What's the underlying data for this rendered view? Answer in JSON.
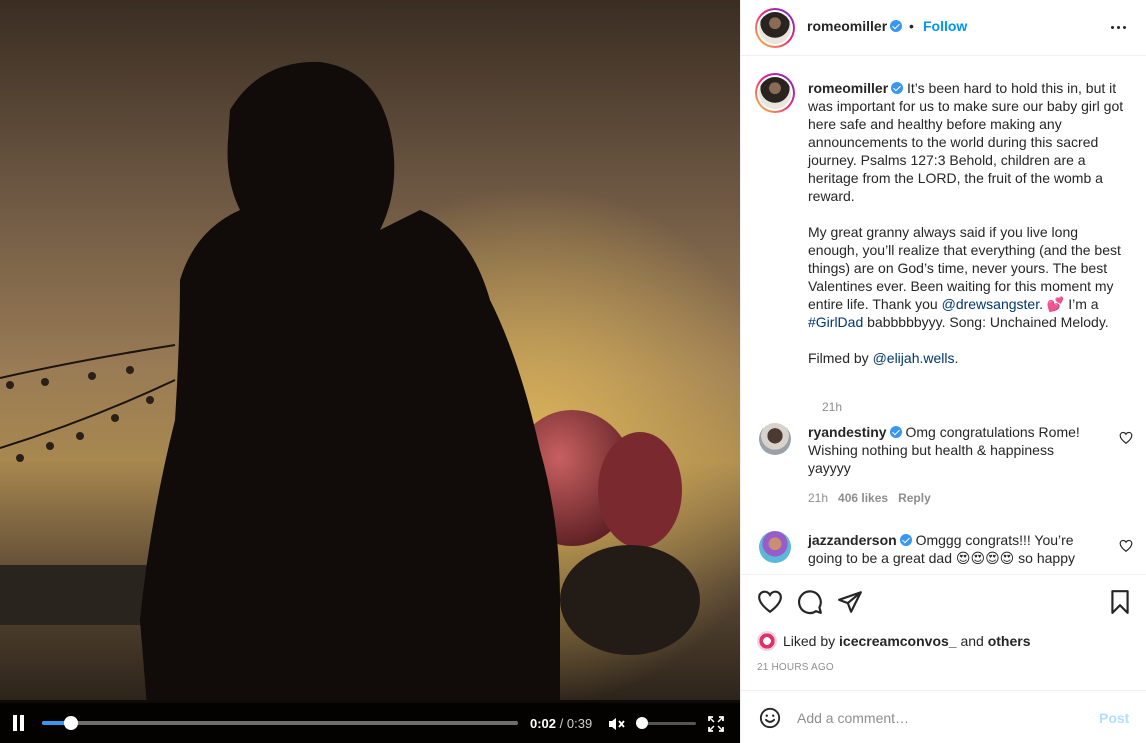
{
  "video": {
    "current_time": "0:02",
    "separator": " / ",
    "duration": "0:39",
    "progress": 0.06,
    "volume": 0.0
  },
  "header": {
    "username": "romeomiller",
    "dot": "•",
    "follow_label": "Follow"
  },
  "caption": {
    "username": "romeomiller",
    "para1": " It’s been hard to hold this in, but it was important for us to make sure our baby girl got here safe and healthy before making any announcements to the world during this sacred journey. Psalms 127:3 Behold, children are a heritage from the LORD, the fruit of the womb a reward.",
    "para2_a": "My great granny always said if you live long enough, you’ll realize that everything (and the best things) are on God’s time, never yours. The best Valentines ever. Been waiting for this moment my entire life. Thank you ",
    "para2_mention": "@drewsangster",
    "para2_b": ". 💕 I’m a ",
    "para2_hashtag": "#GirlDad",
    "para2_c": " babbbbbyyy. Song: Unchained Melody.",
    "para3_a": "Filmed by ",
    "para3_mention": "@elijah.wells",
    "para3_b": ".",
    "time": "21h"
  },
  "comments": [
    {
      "username": "ryandestiny",
      "text": " Omg congratulations Rome! Wishing nothing but health & happiness yayyyy",
      "time": "21h",
      "likes": "406 likes",
      "reply": "Reply"
    },
    {
      "username": "jazzanderson",
      "text": " Omggg congrats!!! You’re going to be a great dad 😍😍😍😍 so happy"
    }
  ],
  "likes": {
    "prefix": "Liked by ",
    "user": "icecreamconvos_",
    "middle": " and ",
    "others": "others"
  },
  "timestamp": "21 HOURS AGO",
  "add_comment": {
    "placeholder": "Add a comment…",
    "post_label": "Post"
  },
  "colors": {
    "accent_blue": "#0095f6",
    "link_dark": "#00376b",
    "muted": "#8e8e8e",
    "post_disabled": "#b2dffc"
  }
}
